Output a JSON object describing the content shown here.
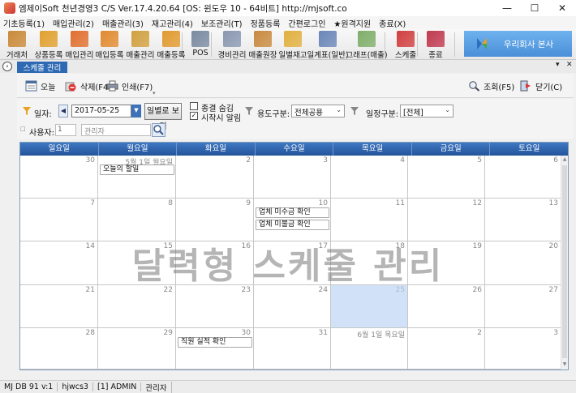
{
  "window": {
    "title": "엠제이Soft 천년경영3 C/S   Ver.17.4.20.64   [OS: 윈도우 10 - 64비트]   http://mjsoft.co",
    "controls": [
      "—",
      "☐",
      "✕"
    ]
  },
  "menu": [
    "기초등록(1)",
    "매입관리(2)",
    "매출관리(3)",
    "재고관리(4)",
    "보조관리(T)",
    "정품등록",
    "간편로그인",
    "★원격지원",
    "종료(X)"
  ],
  "toolbar": {
    "buttons": [
      {
        "label": "거래처",
        "icon": "client-icon",
        "color": "#c98a3a"
      },
      {
        "label": "상품등록",
        "icon": "product-icon",
        "color": "#e0a030"
      },
      {
        "label": "매입관리",
        "icon": "purchase-icon",
        "color": "#e07030"
      },
      {
        "label": "매입등록",
        "icon": "purchase-register-icon",
        "color": "#e08a30"
      },
      {
        "label": "매출관리",
        "icon": "sales-icon",
        "color": "#d0a040"
      },
      {
        "label": "매출등록",
        "icon": "sales-register-icon",
        "color": "#e09a30"
      },
      {
        "label": "POS",
        "icon": "pos-icon",
        "color": "#7a8aa0"
      },
      {
        "label": "경비관리",
        "icon": "expense-icon",
        "color": "#8a98b0"
      },
      {
        "label": "매출원장",
        "icon": "sales-ledger-icon",
        "color": "#c88a40"
      },
      {
        "label": "일별재고",
        "icon": "daily-stock-icon",
        "color": "#e0b040"
      },
      {
        "label": "일계표(일반)",
        "icon": "daily-report-icon",
        "color": "#6a86b8"
      },
      {
        "label": "그래프(매출)",
        "icon": "graph-icon",
        "color": "#7fae6a"
      },
      {
        "label": "스케줄",
        "icon": "schedule-icon",
        "color": "#d04040"
      },
      {
        "label": "종료",
        "icon": "exit-icon",
        "color": "#c03a50"
      }
    ],
    "company_button": "우리회사 본사"
  },
  "tab": {
    "label": "스케줄 관리",
    "pin": "▾",
    "close": "✕"
  },
  "content_toolbar": {
    "today": "오늘",
    "delete": "삭제(F4)",
    "print": "인쇄(F7)",
    "search": "조회(F5)",
    "close": "닫기(C)"
  },
  "filter": {
    "date_label": "일자:",
    "date_value": "2017-05-25",
    "day_view_button": "일별로 보기",
    "checkbox_done": {
      "label": "종결 숨김",
      "checked": false
    },
    "checkbox_alarm": {
      "label": "시작시 알림",
      "checked": true
    },
    "purpose_label": "용도구분:",
    "purpose_value": "전체공용",
    "schedule_label": "일정구분:",
    "schedule_value": "[전체]",
    "user_label": "사용자:",
    "user_num": "1",
    "user_name": "관리자"
  },
  "calendar": {
    "weekdays": [
      "일요일",
      "월요일",
      "화요일",
      "수요일",
      "목요일",
      "금요일",
      "토요일"
    ],
    "weeks": [
      [
        {
          "d": "30"
        },
        {
          "d": "5월 1일 월요일",
          "events": [
            "오늘의 할일"
          ]
        },
        {
          "d": "2"
        },
        {
          "d": "3"
        },
        {
          "d": "4"
        },
        {
          "d": "5"
        },
        {
          "d": "6"
        }
      ],
      [
        {
          "d": "7"
        },
        {
          "d": "8"
        },
        {
          "d": "9"
        },
        {
          "d": "10",
          "events": [
            "업체 미수금 확인",
            "업체 미불금 확인"
          ]
        },
        {
          "d": "11"
        },
        {
          "d": "12"
        },
        {
          "d": "13"
        }
      ],
      [
        {
          "d": "14"
        },
        {
          "d": "15"
        },
        {
          "d": "16"
        },
        {
          "d": "17"
        },
        {
          "d": "18"
        },
        {
          "d": "19"
        },
        {
          "d": "20"
        }
      ],
      [
        {
          "d": "21"
        },
        {
          "d": "22"
        },
        {
          "d": "23"
        },
        {
          "d": "24"
        },
        {
          "d": "25",
          "today": true
        },
        {
          "d": "26"
        },
        {
          "d": "27"
        }
      ],
      [
        {
          "d": "28"
        },
        {
          "d": "29"
        },
        {
          "d": "30",
          "events": [
            "직원 실적 확인"
          ]
        },
        {
          "d": "31"
        },
        {
          "d": "6월 1일 목요일"
        },
        {
          "d": "2"
        },
        {
          "d": "3"
        }
      ]
    ]
  },
  "watermark": "달력형 스케줄 관리",
  "status": [
    "MJ DB 91 v:1",
    "hjwcs3",
    "[1] ADMIN",
    "관리자"
  ]
}
